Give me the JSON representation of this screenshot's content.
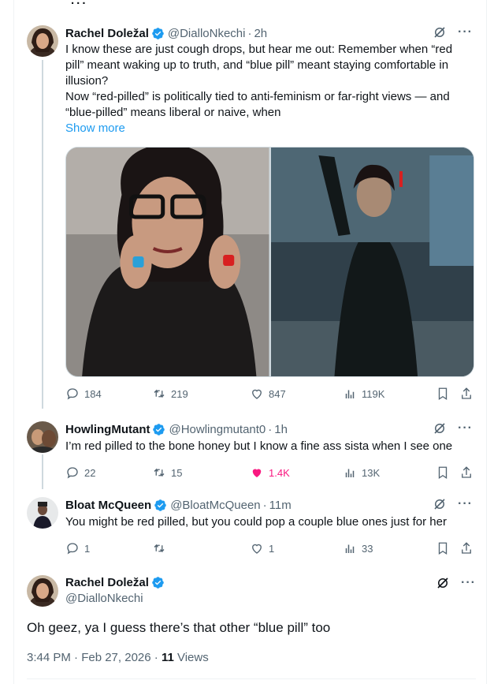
{
  "top_fragment": "...",
  "tweets": [
    {
      "name": "Rachel Doležal",
      "handle": "@DialloNkechi",
      "time": "2h",
      "text_lines": [
        "I know these are just cough drops, but hear me out: Remember when “red pill” meant waking up to truth, and “blue pill” meant staying comfortable in illusion?",
        "Now “red-pilled” is politically tied to anti-feminism or far-right views — and “blue-pilled” means liberal or naive, when"
      ],
      "show_more": "Show more",
      "replies": "184",
      "reposts": "219",
      "likes": "847",
      "views": "119K"
    },
    {
      "name": "HowlingMutant",
      "handle": "@Howlingmutant0",
      "time": "1h",
      "text": "I’m red pilled to the bone honey but I know a fine ass sista when I see one",
      "replies": "22",
      "reposts": "15",
      "likes": "1.4K",
      "views": "13K"
    },
    {
      "name": "Bloat McQueen",
      "handle": "@BloatMcQueen",
      "time": "11m",
      "text": "You might be red pilled, but you could pop a couple blue ones just for her",
      "replies": "1",
      "reposts": "",
      "likes": "1",
      "views": "33"
    }
  ],
  "main": {
    "name": "Rachel Doležal",
    "handle": "@DialloNkechi",
    "text": "Oh geez, ya I guess there’s that other “blue pill” too",
    "timestamp": "3:44 PM · Feb 27, 2026 · ",
    "views_count": "11",
    "views_label": " Views"
  },
  "colors": {
    "accent": "#1d9bf0",
    "like_active": "#f91880",
    "secondary_text": "#536471",
    "primary_text": "#0f1419"
  }
}
